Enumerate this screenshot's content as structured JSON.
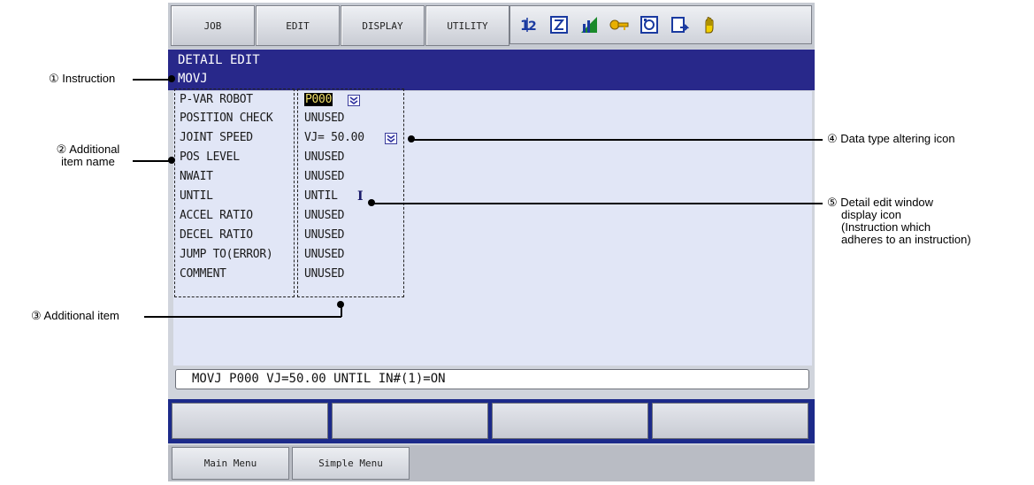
{
  "menubar": {
    "job_label": "JOB",
    "edit_label": "EDIT",
    "display_label": "DISPLAY",
    "utility_label": "UTILITY",
    "status_icons": [
      "sort-icon",
      "edit-mode-icon",
      "signal-icon",
      "key-icon",
      "servo-icon",
      "document-icon",
      "hand-icon"
    ]
  },
  "title_bar": {
    "title": "DETAIL EDIT",
    "instruction": "MOVJ"
  },
  "items": [
    {
      "name": "P-VAR ROBOT",
      "value": "P000"
    },
    {
      "name": "POSITION CHECK",
      "value": "UNUSED"
    },
    {
      "name": "JOINT SPEED",
      "value": "VJ= 50.00"
    },
    {
      "name": "POS LEVEL",
      "value": "UNUSED"
    },
    {
      "name": "NWAIT",
      "value": "UNUSED"
    },
    {
      "name": "UNTIL",
      "value": "UNTIL"
    },
    {
      "name": "ACCEL RATIO",
      "value": "UNUSED"
    },
    {
      "name": "DECEL RATIO",
      "value": "UNUSED"
    },
    {
      "name": "JUMP TO(ERROR)",
      "value": "UNUSED"
    },
    {
      "name": "COMMENT",
      "value": "UNUSED"
    }
  ],
  "detail_icon_glyph": "I",
  "command_line": "MOVJ P000 VJ=50.00 UNTIL IN#(1)=ON",
  "bottom": {
    "main_menu": "Main Menu",
    "simple_menu": "Simple Menu"
  },
  "callouts": {
    "c1": "① Instruction",
    "c2_line1": "② Additional",
    "c2_line2": "item name",
    "c3": "③ Additional item",
    "c4": "④ Data type altering icon",
    "c5_line1": "⑤ Detail edit window",
    "c5_line2": "display icon",
    "c5_line3": "(Instruction which",
    "c5_line4": "adheres to an instruction)"
  },
  "colors": {
    "title_bar": "#28288a",
    "edit_area": "#e1e6f6",
    "function_key_bar": "#1c2a8a",
    "pvar_highlight_text": "#f2e06a"
  }
}
